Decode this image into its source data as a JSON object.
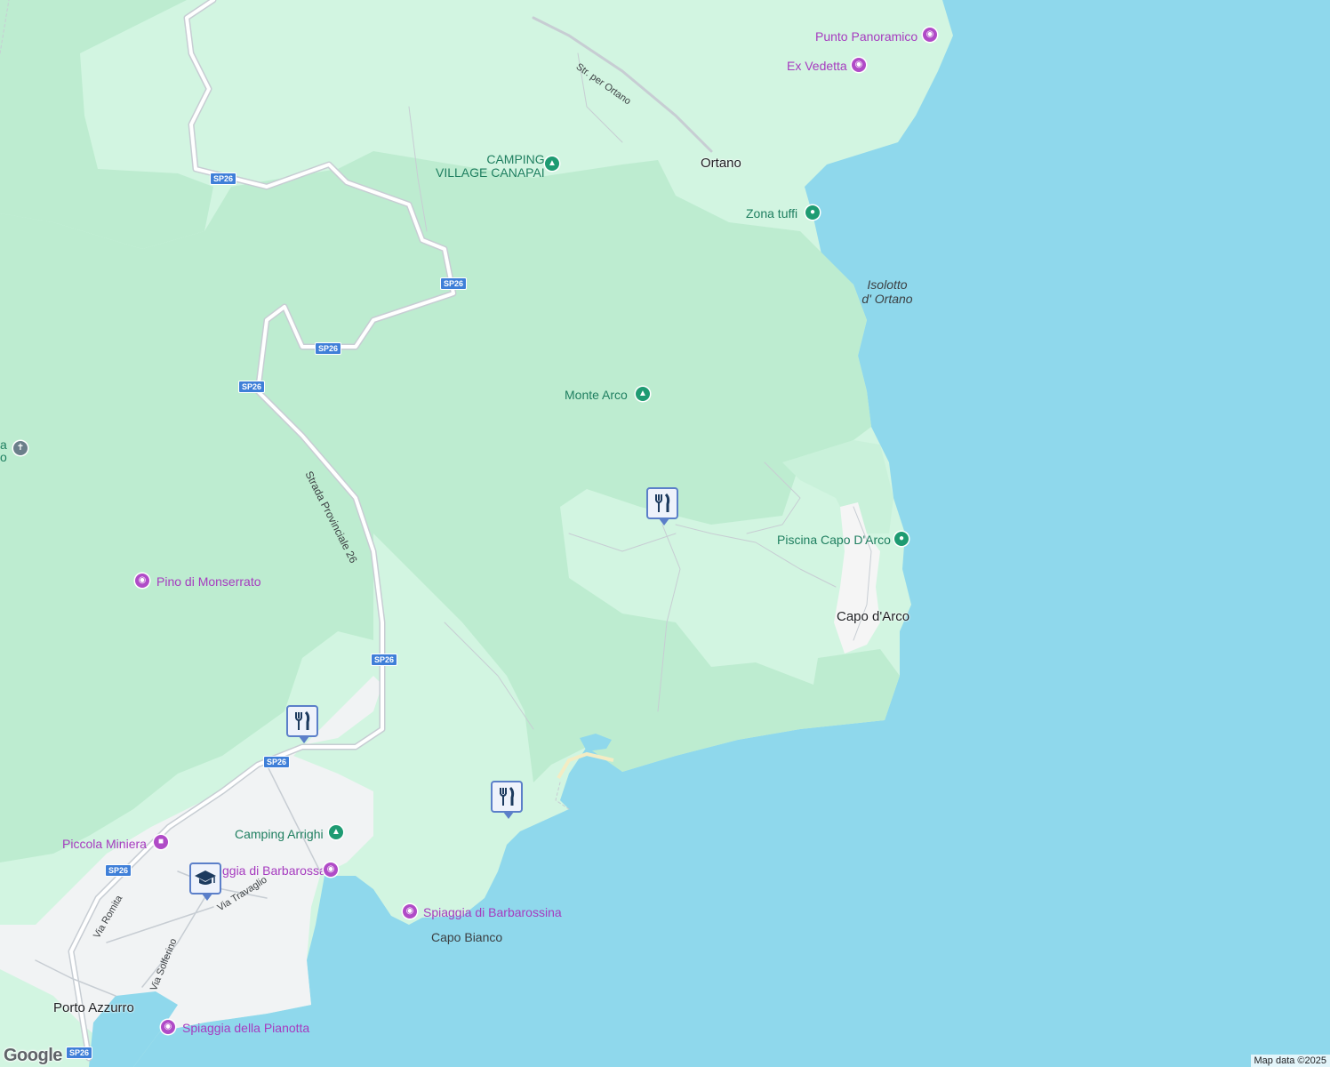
{
  "map": {
    "colors": {
      "sea": "#8fd8ec",
      "land": "#d2f5e1",
      "forest": "#bdecd0",
      "urban": "#f1f3f4",
      "road": "#ffffff",
      "road_casing": "#c7cdd3",
      "shield": "#3f7fd8",
      "poi_purple": "#a63bbf",
      "poi_green": "#1f7f60",
      "marker_border": "#5b7fc9"
    },
    "road_shields": [
      "SP26",
      "SP26",
      "SP26",
      "SP26",
      "SP26",
      "SP26",
      "SP26",
      "SP26"
    ],
    "road_names": {
      "ortano": "Str. per Ortano",
      "provinciale": "Strada Provinciale 26",
      "romita": "Via Romita",
      "travaglio": "Via Travaglio",
      "solferino": "Via Solferino"
    },
    "places": {
      "ortano": "Ortano",
      "capo_darco": "Capo d'Arco",
      "porto_azzurro": "Porto Azzurro",
      "capo_bianco": "Capo Bianco",
      "isolotto_line1": "Isolotto",
      "isolotto_line2": "d' Ortano"
    },
    "pois": {
      "punto_panoramico": {
        "label": "Punto Panoramico",
        "icon": "camera-icon"
      },
      "ex_vedetta": {
        "label": "Ex Vedetta",
        "icon": "camera-icon"
      },
      "camping_canapai_line1": "CAMPING",
      "camping_canapai_line2": "VILLAGE CANAPAI",
      "zona_tuffi": {
        "label": "Zona tuffi",
        "icon": "pin-icon"
      },
      "monte_arco": {
        "label": "Monte Arco",
        "icon": "tree-icon"
      },
      "piscina": {
        "label": "Piscina Capo D'Arco",
        "icon": "pin-icon"
      },
      "pino_monserrato": {
        "label": "Pino di Monserrato",
        "icon": "camera-icon"
      },
      "camping_arrighi": {
        "label": "Camping Arrighi",
        "icon": "tent-icon"
      },
      "piccola_miniera": {
        "label": "Piccola Miniera",
        "icon": "museum-icon"
      },
      "spiaggia_barbarossa": {
        "label": "ggia di Barbarossa",
        "icon": "camera-icon"
      },
      "spiaggia_barbarossina": {
        "label": "Spiaggia di Barbarossina",
        "icon": "camera-icon"
      },
      "spiaggia_pianotta": {
        "label": "Spiaggia della Pianotta",
        "icon": "camera-icon"
      },
      "left_edge_1": "a",
      "left_edge_2": "o"
    },
    "markers": [
      {
        "type": "restaurant",
        "icon": "fork-knife-icon"
      },
      {
        "type": "restaurant",
        "icon": "fork-knife-icon"
      },
      {
        "type": "restaurant",
        "icon": "fork-knife-icon"
      },
      {
        "type": "school",
        "icon": "graduation-cap-icon"
      }
    ],
    "logo": "Google",
    "attribution": "Map data ©2025"
  }
}
